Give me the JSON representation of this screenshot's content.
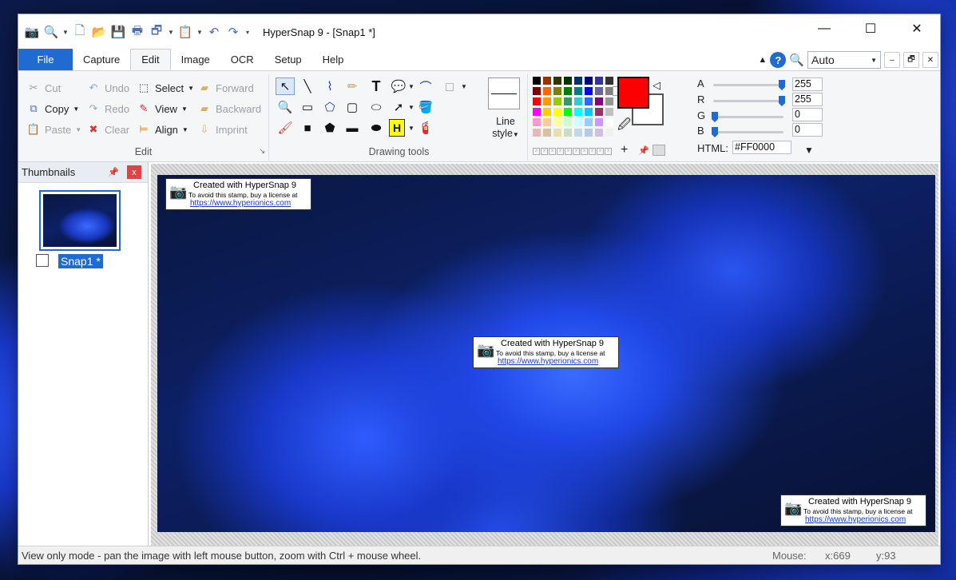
{
  "window": {
    "title": "HyperSnap 9 - [Snap1 *]",
    "min_icon": "—",
    "max_icon": "☐",
    "close_icon": "✕"
  },
  "tabs": [
    {
      "label": "File"
    },
    {
      "label": "Capture"
    },
    {
      "label": "Edit"
    },
    {
      "label": "Image"
    },
    {
      "label": "OCR"
    },
    {
      "label": "Setup"
    },
    {
      "label": "Help"
    }
  ],
  "zoom": {
    "value": "Auto"
  },
  "edit_group": {
    "label": "Edit",
    "cut": "Cut",
    "copy": "Copy",
    "paste": "Paste",
    "undo": "Undo",
    "redo": "Redo",
    "clear": "Clear",
    "select": "Select",
    "view": "View",
    "align": "Align",
    "forward": "Forward",
    "backward": "Backward",
    "imprint": "Imprint"
  },
  "drawing_group": {
    "label": "Drawing tools",
    "line_style": "Line",
    "line_style2": "style",
    "highlight_letter": "H"
  },
  "color": {
    "selected": "#FF0000",
    "html_label": "HTML:",
    "html_value": "#FF0000",
    "a_label": "A",
    "r_label": "R",
    "g_label": "G",
    "b_label": "B",
    "a": 255,
    "r": 255,
    "g": 0,
    "b": 0,
    "a_value": "255",
    "r_value": "255",
    "g_value": "0",
    "b_value": "0",
    "palette": [
      "#000000",
      "#993300",
      "#333300",
      "#003300",
      "#003366",
      "#000080",
      "#333399",
      "#333333",
      "#800000",
      "#FF6600",
      "#808000",
      "#008000",
      "#008080",
      "#0000FF",
      "#666699",
      "#808080",
      "#FF0000",
      "#FF9900",
      "#99CC00",
      "#339966",
      "#33CCCC",
      "#3366FF",
      "#800080",
      "#969696",
      "#FF00FF",
      "#FFCC00",
      "#FFFF00",
      "#00FF00",
      "#00FFFF",
      "#00CCFF",
      "#993366",
      "#C0C0C0",
      "#FF99CC",
      "#FFCC99",
      "#FFFF99",
      "#CCFFCC",
      "#CCFFFF",
      "#99CCFF",
      "#CC99FF",
      "#FFFFFF",
      "#E6B8B7",
      "#D8C0A0",
      "#E8E0A8",
      "#C8E0C0",
      "#C0D8E8",
      "#B8C8E8",
      "#D0C0E0",
      "#F0F0F0"
    ]
  },
  "thumbnails": {
    "title": "Thumbnails",
    "pin": "📌",
    "close": "x",
    "item_label": "Snap1 *"
  },
  "stamp": {
    "line1": "Created with HyperSnap 9",
    "line2": "To avoid this stamp, buy a license at",
    "line3": "https://www.hyperionics.com"
  },
  "status": {
    "message": "View only mode - pan the image with left mouse button, zoom with Ctrl + mouse wheel.",
    "mouse_label": "Mouse:",
    "x": "x:669",
    "y": "y:93"
  }
}
